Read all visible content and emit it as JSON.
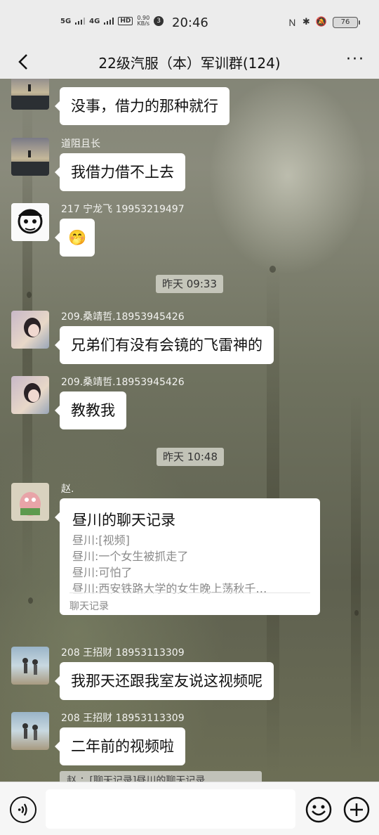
{
  "status_bar": {
    "network1": "5G",
    "network2": "4G",
    "hd": "HD",
    "speed_value": "0.90",
    "speed_unit": "KB/s",
    "notif_count": "3",
    "time": "20:46",
    "battery": "76"
  },
  "header": {
    "title": "22级汽服（本）军训群(124)",
    "more": "···"
  },
  "messages": [
    {
      "sender": "道阻且长",
      "text": "没事，借力的那种就行"
    },
    {
      "sender": "道阻且长",
      "text": "我借力借不上去"
    },
    {
      "sender": "217 宁龙飞 19953219497",
      "text": "🤭"
    },
    {
      "time": "昨天 09:33"
    },
    {
      "sender": "209.桑靖哲.18953945426",
      "text": "兄弟们有没有会镜的飞雷神的"
    },
    {
      "sender": "209.桑靖哲.18953945426",
      "text": "教教我"
    },
    {
      "time": "昨天 10:48"
    },
    {
      "sender": "赵.",
      "record": {
        "title": "昼川的聊天记录",
        "lines": [
          "昼川:[视频]",
          "昼川:一个女生被抓走了",
          "昼川:可怕了",
          "昼川:西安铁路大学的女生晚上荡秋千…"
        ],
        "footer": "聊天记录"
      }
    },
    {
      "sender": "208 王招财 18953113309",
      "text": "我那天还跟我室友说这视频呢"
    },
    {
      "sender": "208 王招财 18953113309",
      "text": "二年前的视频啦"
    }
  ],
  "quote": "赵.：[聊天记录]昼川的聊天记录",
  "input": {
    "value": ""
  },
  "colors": {
    "bubble": "#ffffff",
    "bar": "#ececec",
    "sender_text": "#f3f3f0"
  }
}
